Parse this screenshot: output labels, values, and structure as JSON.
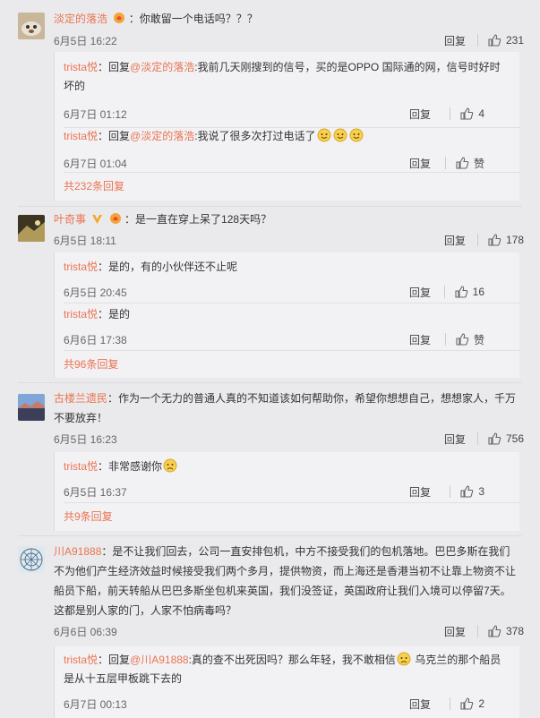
{
  "like_icon": "thumbs-up-icon",
  "reply_label": "回复",
  "comments": [
    {
      "user": "淡定的落浩",
      "text": "：你敢留一个电话吗？？？",
      "time": "6月5日 16:22",
      "likes": "231",
      "replies": [
        {
          "user": "trista悦",
          "prefix": "：回复",
          "mention": "@淡定的落浩",
          "text": ":我前几天刚搜到的信号，买的是OPPO 国际通的网，信号时好时",
          "text2": "坏的",
          "time": "6月7日 01:12",
          "likes": "4"
        },
        {
          "user": "trista悦",
          "prefix": "：回复",
          "mention": "@淡定的落浩",
          "text": ":我说了很多次打过电话了",
          "time": "6月7日 01:04",
          "likes": "赞"
        }
      ],
      "more": "共232条回复"
    },
    {
      "user": "叶奇事",
      "text": "：是一直在穿上呆了128天吗？",
      "time": "6月5日 18:11",
      "likes": "178",
      "replies": [
        {
          "user": "trista悦",
          "text": "：是的，有的小伙伴还不止呢",
          "time": "6月5日 20:45",
          "likes": "16"
        },
        {
          "user": "trista悦",
          "text": "：是的",
          "time": "6月6日 17:38",
          "likes": "赞"
        }
      ],
      "more": "共96条回复"
    },
    {
      "user": "古楼兰遗民",
      "text": "：作为一个无力的普通人真的不知道该如何帮助你，希望你想想自己，想想家人，千万",
      "text2": "不要放弃！",
      "time": "6月5日 16:23",
      "likes": "756",
      "replies": [
        {
          "user": "trista悦",
          "text": "：非常感谢你",
          "time": "6月5日 16:37",
          "likes": "3"
        }
      ],
      "more": "共9条回复"
    },
    {
      "user": "川A91888",
      "text": "：是不让我们回去，公司一直安排包机，中方不接受我们的包机落地。巴巴多斯在我们",
      "text2": "不为他们产生经济效益时候接受我们两个多月，提供物资，而上海还是香港当初不让靠上物资不让",
      "text3": "船员下船，前天转船从巴巴多斯坐包机来英国，我们没签证，英国政府让我们入境可以停留7天。",
      "text4": "这都是别人家的门，人家不怕病毒吗？",
      "time": "6月6日 06:39",
      "likes": "378",
      "replies": [
        {
          "user": "trista悦",
          "prefix": "：回复",
          "mention": "@川A91888",
          "text": ":真的查不出死因吗？那么年轻，我不敢相信",
          "text_b": " 乌克兰的那个船员",
          "text2": "是从十五层甲板跳下去的",
          "time": "6月7日 00:13",
          "likes": "2"
        }
      ]
    }
  ]
}
